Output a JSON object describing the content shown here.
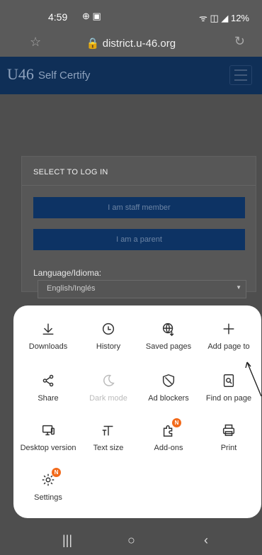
{
  "status": {
    "time": "4:59",
    "left_icons": "⊕ ▣",
    "right": "ᯤ ◫ ◢ 12%"
  },
  "browser": {
    "url": "district.u-46.org"
  },
  "app": {
    "logo": "U46",
    "title": "Self Certify"
  },
  "card": {
    "title": "SELECT TO LOG IN",
    "staff_button": "I am staff member",
    "parent_button": "I am a parent",
    "language_label": "Language/Idioma:",
    "language_value": "English/Inglés"
  },
  "menu": {
    "items": [
      {
        "label": "Downloads",
        "icon": "download-icon"
      },
      {
        "label": "History",
        "icon": "clock-icon"
      },
      {
        "label": "Saved pages",
        "icon": "globe-download-icon"
      },
      {
        "label": "Add page to",
        "icon": "plus-icon"
      },
      {
        "label": "Share",
        "icon": "share-icon"
      },
      {
        "label": "Dark mode",
        "icon": "moon-icon",
        "disabled": true
      },
      {
        "label": "Ad blockers",
        "icon": "shield-icon"
      },
      {
        "label": "Find on page",
        "icon": "find-page-icon"
      },
      {
        "label": "Desktop version",
        "icon": "desktop-icon"
      },
      {
        "label": "Text size",
        "icon": "text-size-icon"
      },
      {
        "label": "Add-ons",
        "icon": "puzzle-icon",
        "badge": "N"
      },
      {
        "label": "Print",
        "icon": "print-icon"
      },
      {
        "label": "Settings",
        "icon": "gear-icon",
        "badge": "N"
      }
    ]
  },
  "colors": {
    "badge": "#f26a1b",
    "appbar": "#0f2f57",
    "button": "#0d3364"
  }
}
